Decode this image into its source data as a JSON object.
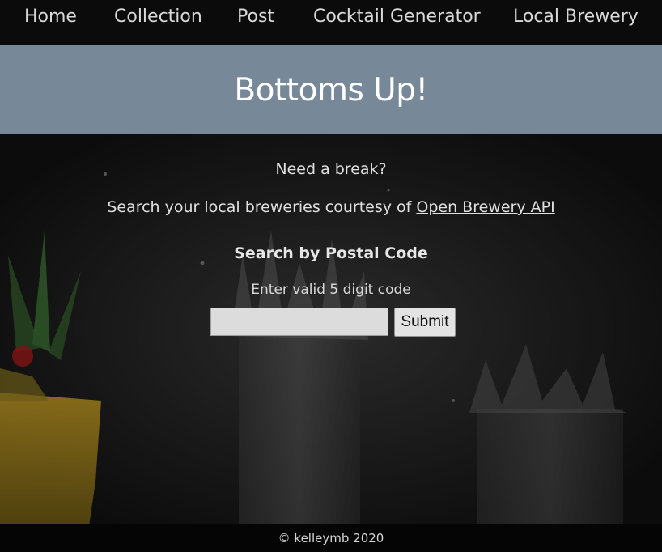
{
  "nav": {
    "items": [
      {
        "label": "Home"
      },
      {
        "label": "Collection"
      },
      {
        "label": "Post"
      },
      {
        "label": "Cocktail Generator"
      },
      {
        "label": "Local Brewery"
      }
    ]
  },
  "header": {
    "title": "Bottoms Up!"
  },
  "main": {
    "tagline": "Need a break?",
    "subtitle_prefix": "Search your local breweries courtesy of ",
    "subtitle_link": "Open Brewery API",
    "search_heading": "Search by Postal Code",
    "search_hint": "Enter valid 5 digit code",
    "postal_value": "",
    "postal_placeholder": "",
    "submit_label": "Submit"
  },
  "footer": {
    "text": "© kelleymb 2020"
  },
  "colors": {
    "nav_bg": "#0b0b0b",
    "header_bg": "#778899",
    "page_bg": "#0d0d0d",
    "text": "#e0e0e0"
  }
}
